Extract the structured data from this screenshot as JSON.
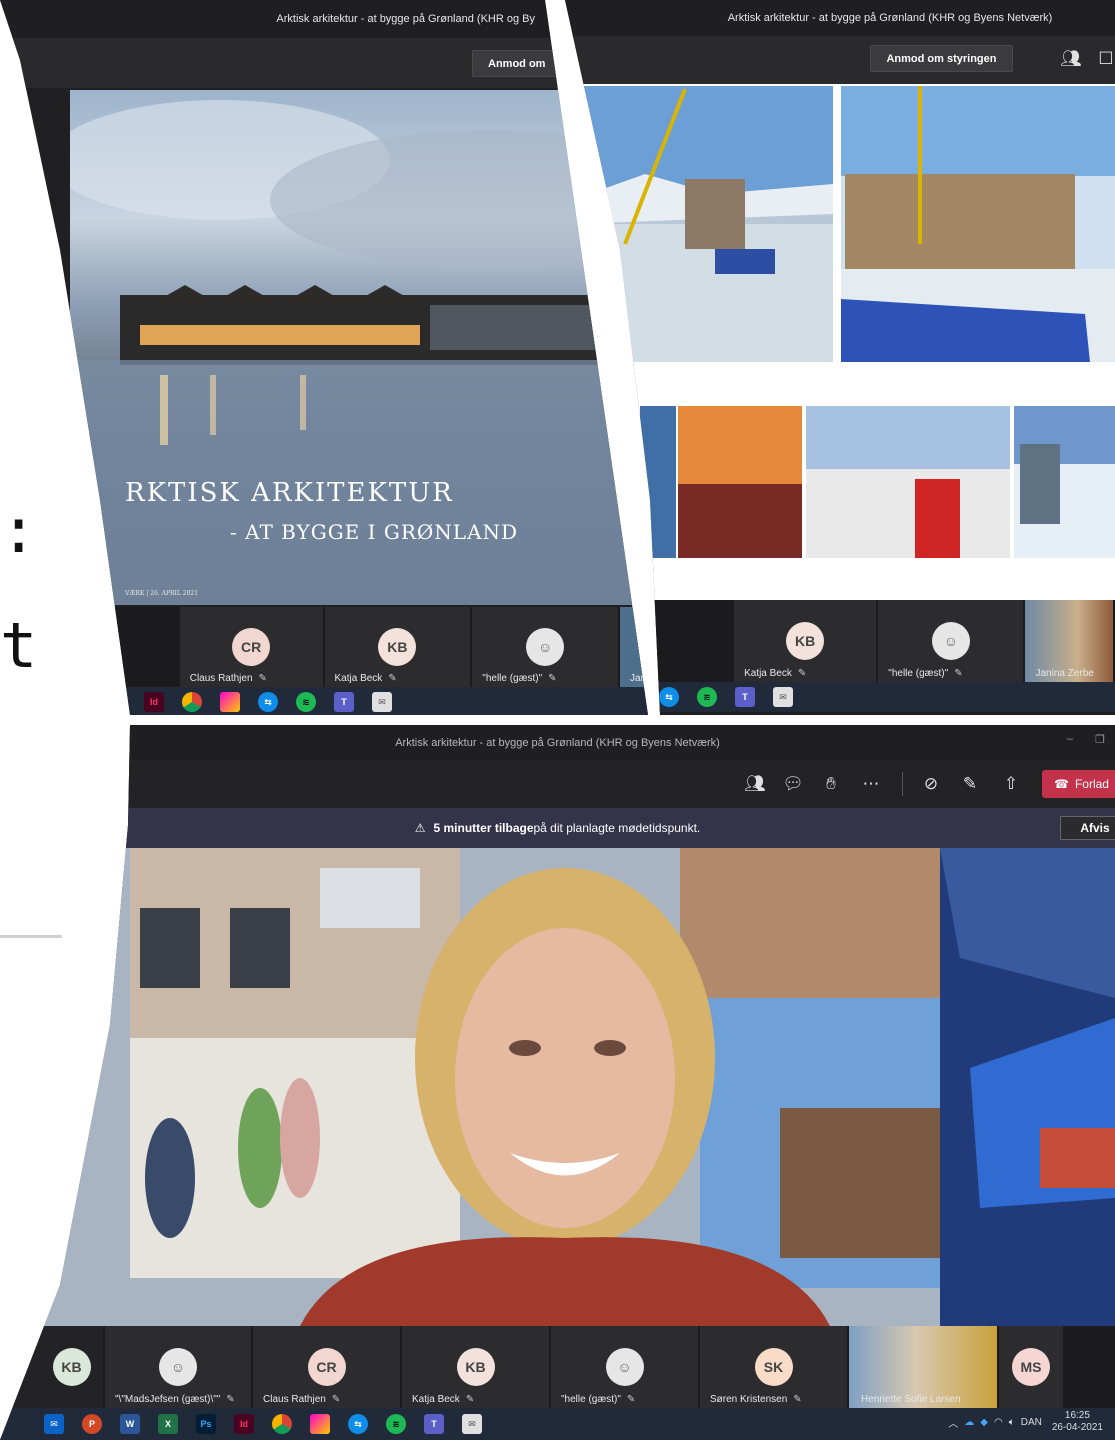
{
  "left_slide": {
    "char_colon": ":",
    "char_t": "t"
  },
  "window1": {
    "title": "Arktisk arkitektur - at bygge på Grønland (KHR og By",
    "request_button": "Anmod om",
    "slide": {
      "heading_line1": "RKTISK ARKITEKTUR",
      "heading_line2": "- AT BYGGE I GRØNLAND",
      "footer": "VÆRK | 26. APRIL 2021"
    },
    "participants": [
      {
        "initials": "CR",
        "name": "Claus Rathjen"
      },
      {
        "initials": "KB",
        "name": "Katja Beck"
      },
      {
        "initials": "",
        "name": "\"helle (gæst)\""
      },
      {
        "initials": "",
        "name": "Jar"
      }
    ]
  },
  "window2": {
    "title": "Arktisk arkitektur - at bygge på Grønland (KHR og Byens Netværk)",
    "request_button": "Anmod om styringen",
    "participants": [
      {
        "initials": "KB",
        "name": "Katja Beck"
      },
      {
        "initials": "",
        "name": "\"helle (gæst)\""
      },
      {
        "initials": "",
        "name": "Janina Zerbe"
      }
    ]
  },
  "window3": {
    "title": "Arktisk arkitektur - at bygge på Grønland (KHR og Byens Netværk)",
    "leave_button": "Forlad",
    "banner": {
      "bold": "5 minutter tilbage",
      "rest": " på dit planlagte mødetidspunkt.",
      "dismiss": "Afvis"
    },
    "participants": [
      {
        "initials": "KB",
        "name": ""
      },
      {
        "initials": "",
        "name": "\"\\\"MadsJefsen (gæst)\\\"\""
      },
      {
        "initials": "CR",
        "name": "Claus Rathjen"
      },
      {
        "initials": "KB",
        "name": "Katja Beck"
      },
      {
        "initials": "",
        "name": "\"helle (gæst)\""
      },
      {
        "initials": "SK",
        "name": "Søren Kristensen"
      },
      {
        "initials": "",
        "name": "Henriette Sofie Larsen"
      },
      {
        "initials": "MS",
        "name": ""
      }
    ],
    "taskbar": {
      "lang": "DAN",
      "time": "16:25",
      "date": "26-04-2021"
    }
  },
  "colors": {
    "leave_red": "#c4314b",
    "teams_dark": "#202022",
    "banner_bg": "#33344a"
  }
}
